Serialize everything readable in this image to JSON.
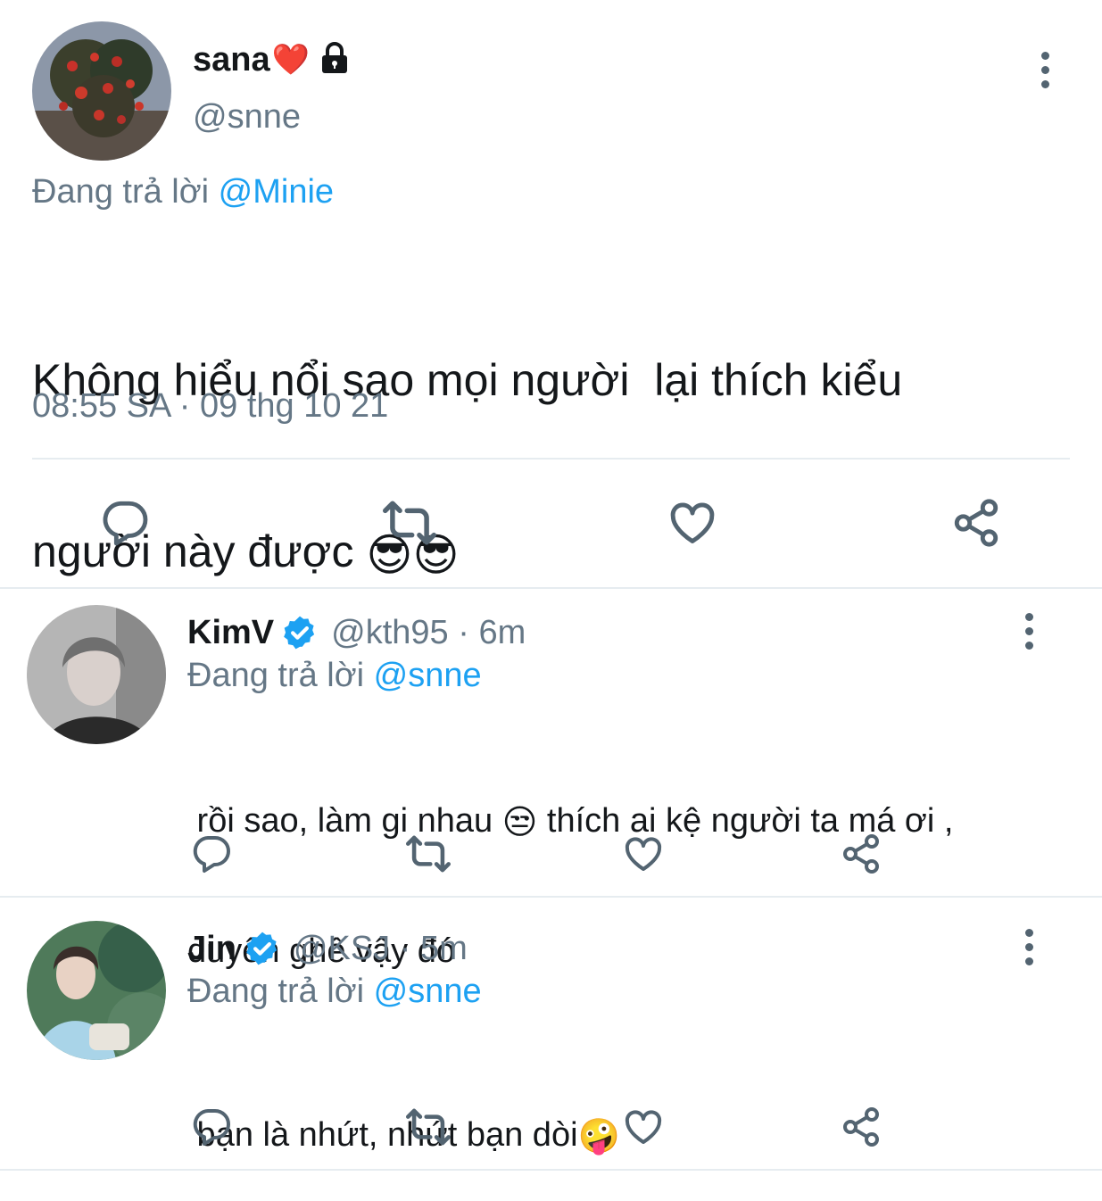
{
  "main_tweet": {
    "display_name": "sana",
    "heart_emoji": "❤️",
    "lock_icon": "lock-icon",
    "handle": "@snne",
    "reply_prefix": "Đang trả lời",
    "reply_to": "@Minie",
    "text_line1": "Không hiểu nổi sao mọi người  lại thích kiểu",
    "text_line2": "người này được",
    "emojis": "😎😎",
    "timestamp": "08:55 SA · 09 thg 10 21"
  },
  "replies": [
    {
      "display_name": "KimV",
      "verified": true,
      "handle_time": "@kth95 · 6m",
      "reply_prefix": "Đang trả lời",
      "reply_to": "@snne",
      "text_before_emoji": " rồi sao, làm gi nhau ",
      "emoji": "😒",
      "text_after_emoji": " thích ai kệ người ta má ơi ,",
      "text_line2": "duyên ghê vậy đó"
    },
    {
      "display_name": "Jin",
      "verified": true,
      "handle_time": "@KSJ · 5m",
      "reply_prefix": "Đang trả lời",
      "reply_to": "@snne",
      "text_before_emoji": " bạn là nhứt, nhứt bạn dòi",
      "emoji": "🤪"
    }
  ],
  "colors": {
    "link": "#1da1f2",
    "secondary_text": "#657786",
    "icon": "#536471",
    "divider": "#e6ecf0"
  }
}
